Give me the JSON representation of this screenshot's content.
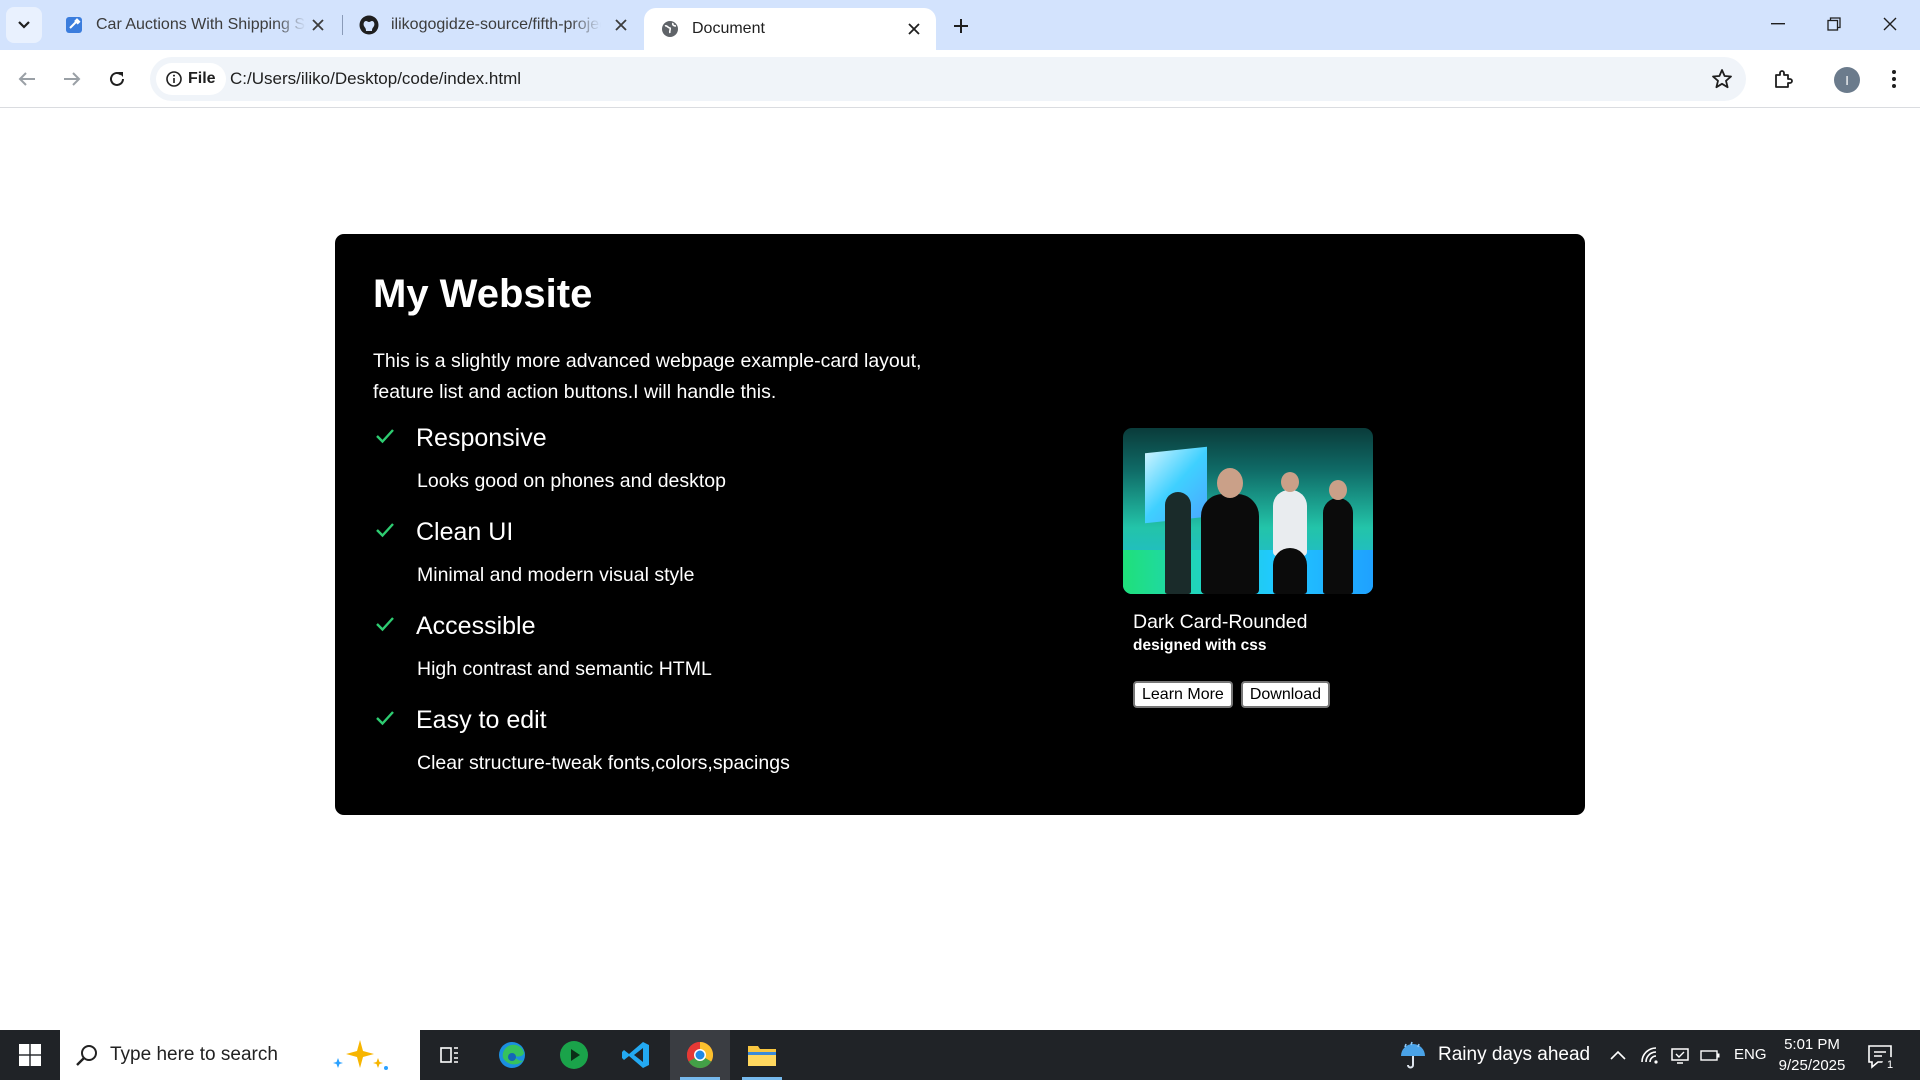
{
  "browser": {
    "tabs": [
      {
        "title": "Car Auctions With Shipping Ser",
        "active": false,
        "favicon": "auction-favicon"
      },
      {
        "title": "ilikogogidze-source/fifth-projec",
        "active": false,
        "favicon": "github-icon"
      },
      {
        "title": "Document",
        "active": true,
        "favicon": "globe-icon"
      }
    ],
    "address": {
      "chip_label": "File",
      "url": "C:/Users/iliko/Desktop/code/index.html"
    },
    "profile_initial": "I"
  },
  "page": {
    "title": "My Website",
    "intro": "This is a slightly more advanced webpage example-card layout, feature list and action buttons.I will handle this.",
    "features": [
      {
        "title": "Responsive",
        "description": "Looks good on phones and desktop"
      },
      {
        "title": "Clean UI",
        "description": "Minimal and modern visual style"
      },
      {
        "title": "Accessible",
        "description": "High contrast and semantic HTML"
      },
      {
        "title": "Easy to edit",
        "description": "Clear structure-tweak fonts,colors,spacings"
      }
    ],
    "media": {
      "caption_title": "Dark Card-Rounded",
      "caption_sub": "designed with css",
      "buttons": {
        "learn_more": "Learn More",
        "download": "Download"
      }
    },
    "colors": {
      "card_bg": "#000000",
      "check": "#2ecc71",
      "text": "#ffffff"
    }
  },
  "taskbar": {
    "search_placeholder": "Type here to search",
    "weather": "Rainy days ahead",
    "language": "ENG",
    "time": "5:01 PM",
    "date": "9/25/2025",
    "notification_count": "1",
    "apps": [
      "task-view",
      "edge",
      "media-player",
      "vscode",
      "chrome",
      "file-explorer"
    ]
  }
}
